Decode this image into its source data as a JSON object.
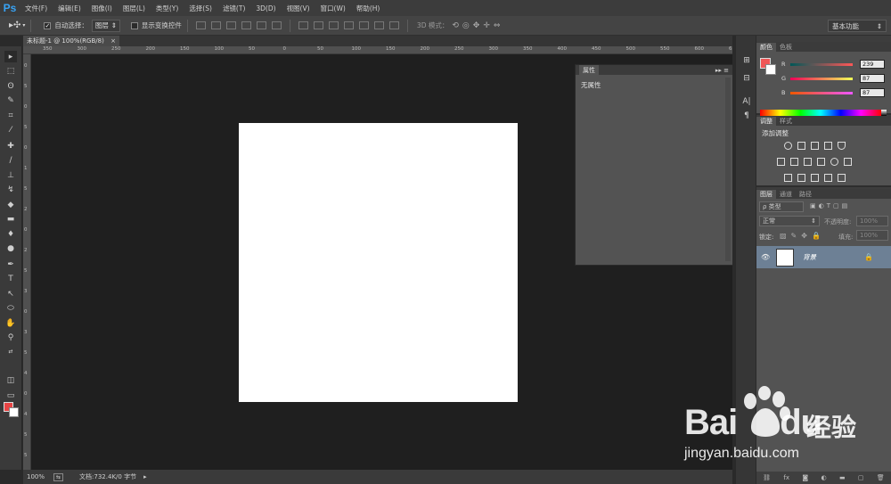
{
  "app": {
    "logo": "Ps"
  },
  "menu": [
    "文件(F)",
    "编辑(E)",
    "图像(I)",
    "图层(L)",
    "类型(Y)",
    "选择(S)",
    "滤镜(T)",
    "3D(D)",
    "视图(V)",
    "窗口(W)",
    "帮助(H)"
  ],
  "options": {
    "auto_select_label": "自动选择：",
    "auto_select_value": "图层",
    "show_transform_label": "显示变换控件",
    "mode_3d_label": "3D 模式：",
    "workspace": "基本功能"
  },
  "document": {
    "tab_title": "未标题-1 @ 100%(RGB/8)",
    "tab_close": "×",
    "zoom": "100%",
    "doc_info": "文档:732.4K/0 字节"
  },
  "rulers": {
    "h_ticks": [
      "350",
      "300",
      "250",
      "200",
      "150",
      "100",
      "50",
      "0",
      "50",
      "100",
      "150",
      "200",
      "250",
      "300",
      "350",
      "400",
      "450",
      "500",
      "550",
      "600",
      "650"
    ],
    "v_ticks": [
      "0",
      "5",
      "0",
      "5",
      "0",
      "1",
      "5",
      "2",
      "0",
      "2",
      "5",
      "3",
      "0",
      "3",
      "5",
      "4",
      "0",
      "4",
      "5",
      "5"
    ]
  },
  "properties": {
    "title": "属性",
    "empty_text": "无属性"
  },
  "color_panel": {
    "tabs": [
      "颜色",
      "色板"
    ],
    "channels": [
      {
        "label": "R",
        "value": "239"
      },
      {
        "label": "G",
        "value": "87"
      },
      {
        "label": "B",
        "value": "87"
      }
    ],
    "foreground": "#ef5757",
    "background": "#ffffff"
  },
  "adjustments_panel": {
    "tabs": [
      "调整",
      "样式"
    ],
    "heading": "添加调整"
  },
  "layers_panel": {
    "tabs": [
      "图层",
      "通道",
      "路径"
    ],
    "filter_label": "ρ 类型",
    "blend_mode": "正常",
    "opacity_label": "不透明度:",
    "opacity_value": "100%",
    "lock_label": "锁定:",
    "fill_label": "填充:",
    "fill_value": "100%",
    "layers": [
      {
        "name": "背景"
      }
    ]
  },
  "watermark": {
    "brand": "Bai",
    "brand2": "du",
    "cn": "经验",
    "url": "jingyan.baidu.com"
  }
}
